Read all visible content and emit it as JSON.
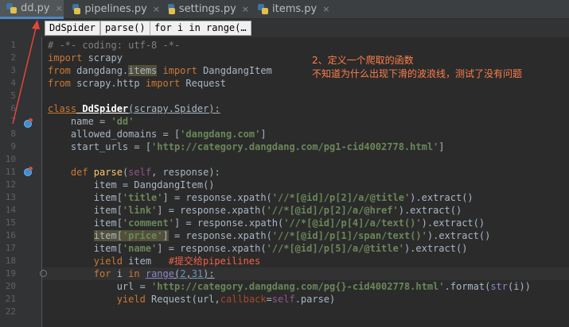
{
  "tabs": [
    {
      "label": "dd.py",
      "close": "×",
      "active": true
    },
    {
      "label": "pipelines.py",
      "close": "×",
      "active": false
    },
    {
      "label": "settings.py",
      "close": "×",
      "active": false
    },
    {
      "label": "items.py",
      "close": "×",
      "active": false
    }
  ],
  "breadcrumbs": [
    "DdSpider",
    "parse()",
    "for i in range(…"
  ],
  "line_numbers": [
    "1",
    "2",
    "3",
    "4",
    "5",
    "6",
    "7",
    "8",
    "9",
    "10",
    "11",
    "12",
    "13",
    "14",
    "15",
    "16",
    "17",
    "18",
    "19",
    "20",
    "21",
    "22"
  ],
  "code": {
    "l1": "# -*- coding: utf-8 -*-",
    "l2_kw": "import",
    "l2_mod": " scrapy",
    "l3_kw1": "from",
    "l3_a": " dangdang.",
    "l3_items": "items",
    "l3_kw2": " import",
    "l3_b": " DangdangItem",
    "l4_kw1": "from",
    "l4_a": " scrapy.http ",
    "l4_kw2": "import",
    "l4_b": " Request",
    "l6_kw": "class",
    "l6_cls": " DdSpider",
    "l6_rest": "(scrapy.Spider):",
    "l7_a": "    name = ",
    "l7_s": "'dd'",
    "l8_a": "    allowed_domains = [",
    "l8_s": "'dangdang.com'",
    "l8_b": "]",
    "l9_a": "    start_urls = [",
    "l9_s": "'http://category.dangdang.com/pg1-cid4002778.html'",
    "l9_b": "]",
    "l11_kw": "    def",
    "l11_fn": " parse",
    "l11_a": "(",
    "l11_self": "self",
    "l11_b": ", response):",
    "l12": "        item = DangdangItem()",
    "l13_a": "        item[",
    "l13_k": "'title'",
    "l13_b": "] = response.xpath(",
    "l13_s": "'//*[@id]/p[2]/a/@title'",
    "l13_c": ").extract()",
    "l14_a": "        item[",
    "l14_k": "'link'",
    "l14_b": "] = response.xpath(",
    "l14_s": "'//*[@id]/p[2]/a/@href'",
    "l14_c": ").extract()",
    "l15_a": "        item[",
    "l15_k": "'comment'",
    "l15_b": "] = response.xpath(",
    "l15_s": "'//*[@id]/p[4]/a/text()'",
    "l15_c": ").extract()",
    "l16_a": "        ",
    "l16_item": "item",
    "l16_b": "[",
    "l16_k": "'price'",
    "l16_c": "]",
    "l16_d": " = response.xpath(",
    "l16_s": "'//*[@id]/p[1]/span/text()'",
    "l16_e": ").extract()",
    "l17_a": "        item[",
    "l17_k": "'name'",
    "l17_b": "] = response.xpath(",
    "l17_s": "'//*[@id]/p[5]/a/@title'",
    "l17_c": ").extract()",
    "l18_kw": "        yield",
    "l18_a": " item   ",
    "l18_c": "#提交给pipeilines",
    "l19_kw1": "        for",
    "l19_a": " i ",
    "l19_kw2": "in",
    "l19_sp": " ",
    "l19_bi": "range",
    "l19_b": "(",
    "l19_n1": "2",
    "l19_c": ",",
    "l19_n2": "31",
    "l19_d": "):",
    "l20_a": "            url = ",
    "l20_s": "'http://category.dangdang.com/pg{}-cid4002778.html'",
    "l20_b": ".format(",
    "l20_bi": "str",
    "l20_c": "(i))",
    "l21_kw": "            yield",
    "l21_a": " Request(url,",
    "l21_kw2": "callback",
    "l21_b": "=",
    "l21_self": "self",
    "l21_c": ".parse)"
  },
  "annotation": {
    "line1": "2、定义一个爬取的函数",
    "line2": "不知道为什么出现下滑的波浪线，测试了没有问题",
    "color": "#ff7f4a"
  },
  "colors": {
    "keyword": "#cc7832",
    "string": "#6a8759",
    "comment": "#808080",
    "background": "#2b2b2b"
  }
}
